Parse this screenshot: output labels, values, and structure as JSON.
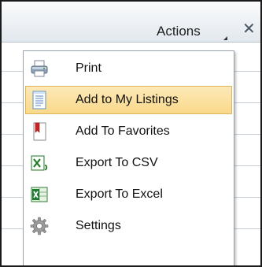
{
  "header": {
    "actions_label": "Actions",
    "close_symbol": "✕"
  },
  "menu": {
    "items": [
      {
        "label": "Print",
        "icon": "printer-icon",
        "highlighted": false
      },
      {
        "label": "Add to My Listings",
        "icon": "document-list-icon",
        "highlighted": true
      },
      {
        "label": "Add To Favorites",
        "icon": "bookmark-icon",
        "highlighted": false
      },
      {
        "label": "Export To CSV",
        "icon": "excel-csv-icon",
        "highlighted": false
      },
      {
        "label": "Export To Excel",
        "icon": "excel-icon",
        "highlighted": false
      },
      {
        "label": "Settings",
        "icon": "gear-icon",
        "highlighted": false
      }
    ]
  },
  "colors": {
    "highlight_bg": "#f9d98a",
    "highlight_border": "#e0b45a",
    "header_bg": "#e2e8ee",
    "frame_border": "#1a1a1a"
  }
}
